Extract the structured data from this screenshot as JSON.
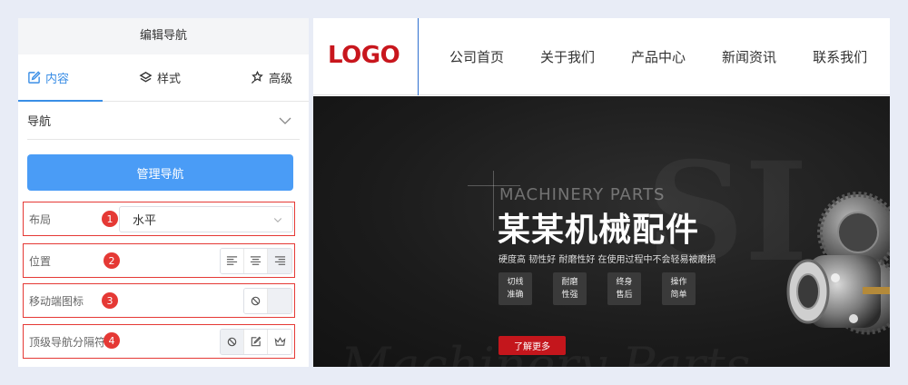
{
  "panel": {
    "title": "编辑导航",
    "tabs": [
      {
        "label": "内容",
        "icon": "edit-icon",
        "active": true
      },
      {
        "label": "样式",
        "icon": "layers-icon",
        "active": false
      },
      {
        "label": "高级",
        "icon": "magic-pin-icon",
        "active": false
      }
    ],
    "section": {
      "label": "导航",
      "icon": "chevron-down-icon"
    },
    "manage_button": "管理导航",
    "options": [
      {
        "label": "布局",
        "badge": "1",
        "value": "水平"
      },
      {
        "label": "位置",
        "badge": "2",
        "buttons": [
          "align-left-icon",
          "align-center-icon",
          "align-right-icon"
        ],
        "selected": 2
      },
      {
        "label": "移动端图标",
        "badge": "3",
        "buttons": [
          "ban-icon",
          "empty"
        ],
        "selected": 1
      },
      {
        "label": "顶级导航分隔符",
        "badge": "4",
        "buttons": [
          "ban-icon",
          "edit-icon",
          "crown-icon"
        ],
        "selected": 0
      }
    ]
  },
  "preview": {
    "logo": "LOGO",
    "nav": [
      "公司首页",
      "关于我们",
      "产品中心",
      "新闻资讯",
      "联系我们"
    ],
    "banner": {
      "bg_letters": "SI",
      "bg_bottom": "Machinery Parts",
      "subtitle_en": "MACHINERY PARTS",
      "title": "某某机械配件",
      "tagline": "硬度高 韧性好 耐磨性好 在使用过程中不会轻易被磨损",
      "features": [
        [
          "切线",
          "准确"
        ],
        [
          "耐磨",
          "性强"
        ],
        [
          "终身",
          "售后"
        ],
        [
          "操作",
          "简单"
        ]
      ],
      "cta": "了解更多"
    }
  },
  "colors": {
    "accent": "#4a9cf6",
    "tab_active": "#3a8ee6",
    "annotation": "#e53935",
    "brand_red": "#c8161d"
  }
}
